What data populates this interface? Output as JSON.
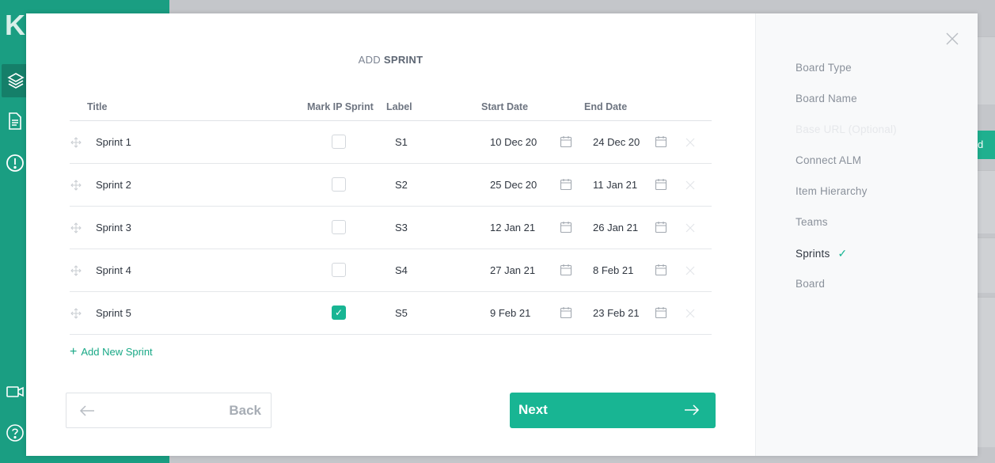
{
  "app": {
    "logo": "K"
  },
  "background": {
    "button_fragment": "d"
  },
  "modal": {
    "title_prefix": "ADD",
    "title_main": "SPRINT",
    "columns": {
      "title": "Title",
      "mark_ip": "Mark IP Sprint",
      "label": "Label",
      "start": "Start Date",
      "end": "End Date"
    },
    "sprints": [
      {
        "title": "Sprint 1",
        "ip": false,
        "label": "S1",
        "start": "10 Dec 20",
        "end": "24 Dec 20"
      },
      {
        "title": "Sprint 2",
        "ip": false,
        "label": "S2",
        "start": "25 Dec 20",
        "end": "11 Jan 21"
      },
      {
        "title": "Sprint 3",
        "ip": false,
        "label": "S3",
        "start": "12 Jan 21",
        "end": "26 Jan 21"
      },
      {
        "title": "Sprint 4",
        "ip": false,
        "label": "S4",
        "start": "27 Jan 21",
        "end": "8 Feb 21"
      },
      {
        "title": "Sprint 5",
        "ip": true,
        "label": "S5",
        "start": "9 Feb 21",
        "end": "23 Feb 21"
      }
    ],
    "add_sprint": "Add New Sprint",
    "back": "Back",
    "next": "Next"
  },
  "steps": [
    {
      "label": "Board Type",
      "state": "done"
    },
    {
      "label": "Board Name",
      "state": "done"
    },
    {
      "label": "Base URL (Optional)",
      "state": "disabled"
    },
    {
      "label": "Connect ALM",
      "state": "done"
    },
    {
      "label": "Item Hierarchy",
      "state": "done"
    },
    {
      "label": "Teams",
      "state": "done"
    },
    {
      "label": "Sprints",
      "state": "current"
    },
    {
      "label": "Board",
      "state": "pending"
    }
  ],
  "colors": {
    "accent": "#18b593",
    "sidebar": "#1a9e82"
  }
}
